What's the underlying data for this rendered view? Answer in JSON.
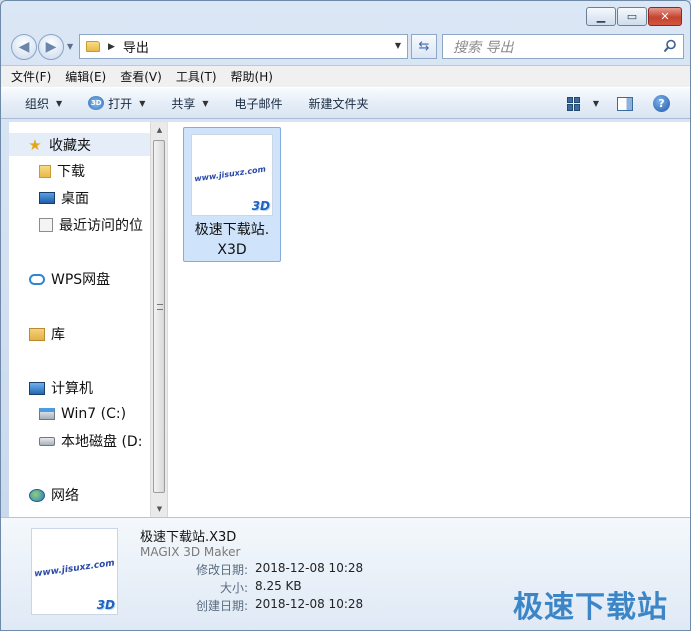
{
  "address": {
    "breadcrumb": "导出"
  },
  "search": {
    "placeholder": "搜索 导出"
  },
  "menu": [
    "文件(F)",
    "编辑(E)",
    "查看(V)",
    "工具(T)",
    "帮助(H)"
  ],
  "toolbar": {
    "organize": "组织",
    "burn": "打开",
    "share": "共享",
    "email": "电子邮件",
    "new_folder": "新建文件夹"
  },
  "sidebar": {
    "favorites": "收藏夹",
    "downloads": "下载",
    "desktop": "桌面",
    "recent": "最近访问的位",
    "wps": "WPS网盘",
    "libraries": "库",
    "computer": "计算机",
    "drive_c": "Win7 (C:)",
    "drive_d": "本地磁盘 (D:",
    "network": "网络"
  },
  "file": {
    "name_line1": "极速下载站.",
    "name_line2": "X3D",
    "thumb_text": "www.jisuxz.com",
    "badge": "3D"
  },
  "details": {
    "name": "极速下载站.X3D",
    "type": "MAGIX 3D Maker",
    "modified_label": "修改日期:",
    "modified": "2018-12-08 10:28",
    "size_label": "大小:",
    "size": "8.25 KB",
    "created_label": "创建日期:",
    "created": "2018-12-08 10:28"
  },
  "watermark": "极速下载站"
}
